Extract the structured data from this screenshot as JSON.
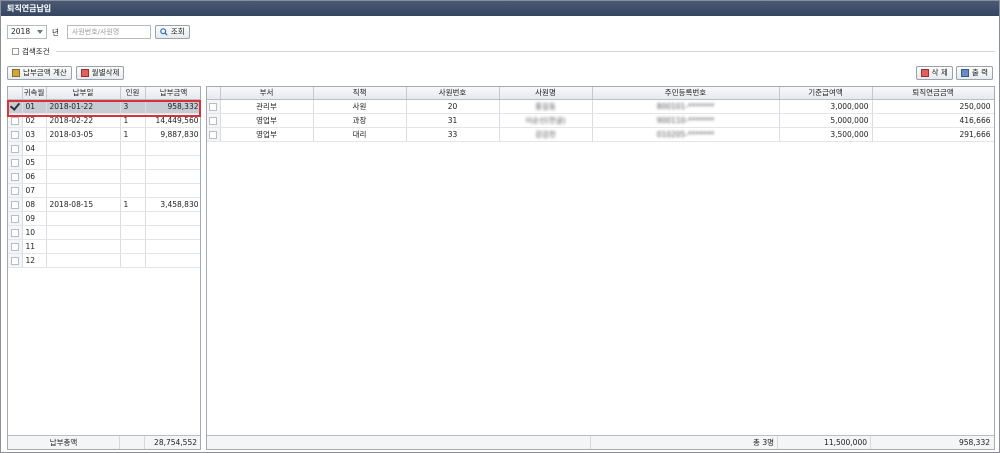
{
  "window": {
    "title": "퇴직연금납입"
  },
  "filters": {
    "year": "2018",
    "year_unit": "년",
    "employee_placeholder": "사원번호/사원명",
    "search_label": "조회",
    "conditions_label": "검색조건"
  },
  "left_toolbar": {
    "calc_label": "납부금액 계산",
    "delete_month_label": "월별삭제"
  },
  "right_toolbar": {
    "delete_label": "삭 제",
    "print_label": "출 력"
  },
  "left_grid": {
    "headers": [
      "귀속월",
      "납부일",
      "인원",
      "납부금액"
    ],
    "rows": [
      {
        "month": "01",
        "date": "2018-01-22",
        "count": "3",
        "amount": "958,332",
        "checked": true
      },
      {
        "month": "02",
        "date": "2018-02-22",
        "count": "1",
        "amount": "14,449,560"
      },
      {
        "month": "03",
        "date": "2018-03-05",
        "count": "1",
        "amount": "9,887,830"
      },
      {
        "month": "04",
        "date": "",
        "count": "",
        "amount": ""
      },
      {
        "month": "05",
        "date": "",
        "count": "",
        "amount": ""
      },
      {
        "month": "06",
        "date": "",
        "count": "",
        "amount": ""
      },
      {
        "month": "07",
        "date": "",
        "count": "",
        "amount": ""
      },
      {
        "month": "08",
        "date": "2018-08-15",
        "count": "1",
        "amount": "3,458,830"
      },
      {
        "month": "09",
        "date": "",
        "count": "",
        "amount": ""
      },
      {
        "month": "10",
        "date": "",
        "count": "",
        "amount": ""
      },
      {
        "month": "11",
        "date": "",
        "count": "",
        "amount": ""
      },
      {
        "month": "12",
        "date": "",
        "count": "",
        "amount": ""
      }
    ],
    "footer": {
      "label": "납부총액",
      "total": "28,754,552"
    }
  },
  "right_grid": {
    "headers": [
      "부서",
      "직책",
      "사원번호",
      "사원명",
      "주민등록번호",
      "기준급여액",
      "퇴직연금금액"
    ],
    "rows": [
      {
        "dept": "관리부",
        "position": "사원",
        "emp_no": "20",
        "name": "홍길동",
        "rrn": "800101-*******",
        "base_pay": "3,000,000",
        "pension": "250,000"
      },
      {
        "dept": "영업부",
        "position": "과장",
        "emp_no": "31",
        "name": "이순신(한글)",
        "rrn": "900110-*******",
        "base_pay": "5,000,000",
        "pension": "416,666"
      },
      {
        "dept": "영업부",
        "position": "대리",
        "emp_no": "33",
        "name": "강감찬",
        "rrn": "010205-*******",
        "base_pay": "3,500,000",
        "pension": "291,666"
      }
    ],
    "footer": {
      "count": "총 3명",
      "base_total": "11,500,000",
      "pension_total": "958,332"
    }
  }
}
